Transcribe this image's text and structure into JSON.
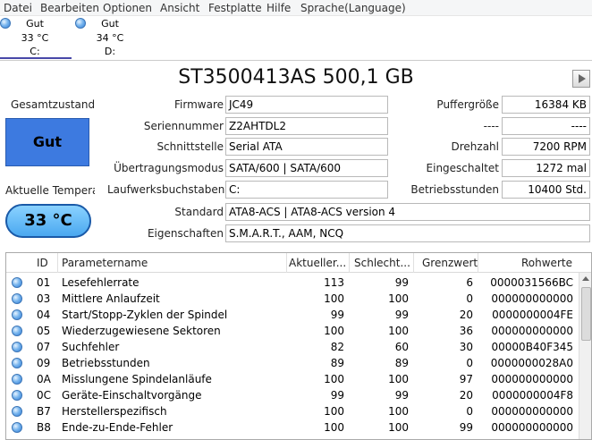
{
  "menu": [
    "Datei",
    "Bearbeiten",
    "Optionen",
    "Ansicht",
    "Festplatte",
    "Hilfe",
    "Sprache(Language)"
  ],
  "disks": [
    {
      "status": "Gut",
      "temp": "33 °C",
      "letter": "C:"
    },
    {
      "status": "Gut",
      "temp": "34 °C",
      "letter": "D:"
    }
  ],
  "title": "ST3500413AS 500,1 GB",
  "left": {
    "health_label": "Gesamtzustand",
    "health_value": "Gut",
    "temp_label": "Aktuelle Temperat",
    "temp_value": "33 °C"
  },
  "fields": {
    "firmware_label": "Firmware",
    "firmware": "JC49",
    "serial_label": "Seriennummer",
    "serial": "Z2AHTDL2",
    "interface_label": "Schnittstelle",
    "interface": "Serial ATA",
    "transfer_label": "Übertragungsmodus",
    "transfer": "SATA/600 | SATA/600",
    "letters_label": "Laufwerksbuchstaben",
    "letters": "C:",
    "standard_label": "Standard",
    "standard": "ATA8-ACS | ATA8-ACS version 4",
    "features_label": "Eigenschaften",
    "features": "S.M.A.R.T., AAM, NCQ",
    "buffer_label": "Puffergröße",
    "buffer": "16384 KB",
    "blank1_label": "----",
    "blank1": "----",
    "rpm_label": "Drehzahl",
    "rpm": "7200 RPM",
    "power_count_label": "Eingeschaltet",
    "power_count": "1272 mal",
    "hours_label": "Betriebsstunden",
    "hours": "10400 Std."
  },
  "table": {
    "headers": [
      "ID",
      "Parametername",
      "Aktueller...",
      "Schlecht...",
      "Grenzwert",
      "Rohwerte"
    ],
    "rows": [
      [
        "01",
        "Lesefehlerrate",
        "113",
        "99",
        "6",
        "0000031566BC"
      ],
      [
        "03",
        "Mittlere Anlaufzeit",
        "100",
        "100",
        "0",
        "000000000000"
      ],
      [
        "04",
        "Start/Stopp-Zyklen der Spindel",
        "99",
        "99",
        "20",
        "0000000004FE"
      ],
      [
        "05",
        "Wiederzugewiesene Sektoren",
        "100",
        "100",
        "36",
        "000000000000"
      ],
      [
        "07",
        "Suchfehler",
        "82",
        "60",
        "30",
        "00000B40F345"
      ],
      [
        "09",
        "Betriebsstunden",
        "89",
        "89",
        "0",
        "0000000028A0"
      ],
      [
        "0A",
        "Misslungene Spindelanläufe",
        "100",
        "100",
        "97",
        "000000000000"
      ],
      [
        "0C",
        "Geräte-Einschaltvorgänge",
        "99",
        "99",
        "20",
        "0000000004F8"
      ],
      [
        "B7",
        "Herstellerspezifisch",
        "100",
        "100",
        "0",
        "000000000000"
      ],
      [
        "B8",
        "Ende-zu-Ende-Fehler",
        "100",
        "100",
        "99",
        "000000000000"
      ]
    ]
  }
}
